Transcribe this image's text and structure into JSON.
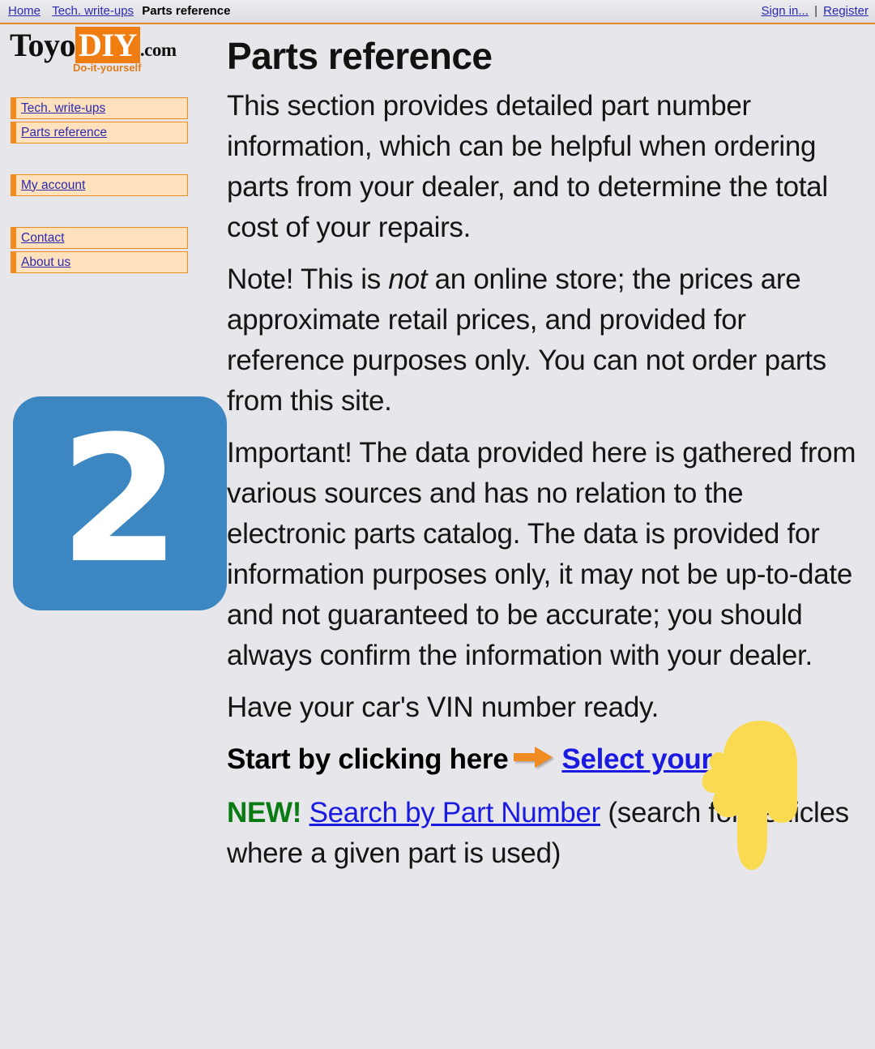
{
  "topbar": {
    "links": [
      {
        "label": "Home",
        "name": "nav-link-home"
      },
      {
        "label": "Tech. write-ups",
        "name": "nav-link-tech-writeups"
      }
    ],
    "current": "Parts reference",
    "signin": "Sign in...",
    "separator": "|",
    "register": "Register"
  },
  "logo": {
    "part1": "Toyo",
    "part2": "DIY",
    "part3": ".com",
    "tagline": "Do-it-yourself",
    "accent_color": "#f07d11"
  },
  "sidebar": {
    "groups": [
      {
        "items": [
          {
            "label": "Tech. write-ups",
            "name": "sidebar-item-tech-writeups"
          },
          {
            "label": "Parts reference",
            "name": "sidebar-item-parts-reference"
          }
        ]
      },
      {
        "items": [
          {
            "label": "My account",
            "name": "sidebar-item-my-account"
          }
        ]
      },
      {
        "items": [
          {
            "label": "Contact",
            "name": "sidebar-item-contact"
          },
          {
            "label": "About us",
            "name": "sidebar-item-about-us"
          }
        ]
      }
    ]
  },
  "step_badge": {
    "number": "2",
    "color": "#3c86c1"
  },
  "main": {
    "title": "Parts reference",
    "paragraph_1": "This section provides detailed part number information, which can be helpful when ordering parts from your dealer, and to determine the total cost of your repairs.",
    "paragraph_2": {
      "before": "Note! This is ",
      "italic": "not",
      "after": " an online store; the prices are approximate retail prices, and provided for reference purposes only. You can not order parts from this site."
    },
    "paragraph_3": "Important! The data provided here is gathered from various sources and has no relation to the electronic parts catalog. The data is provided for information purposes only, it may not be up-to-date and not guaranteed to be accurate; you should always confirm the information with your dealer.",
    "paragraph_4": "Have your car's VIN number ready.",
    "cta": {
      "prefix": "Start by clicking here",
      "arrow_icon": "arrow-right-icon",
      "link": "Select your car"
    },
    "new_line": {
      "badge": "NEW!",
      "link": "Search by Part Number",
      "suffix": " (search for vehicles where a given part is used)"
    }
  },
  "overlay": {
    "hand_icon": "pointing-down-hand-icon",
    "hand_color": "#fada50"
  }
}
